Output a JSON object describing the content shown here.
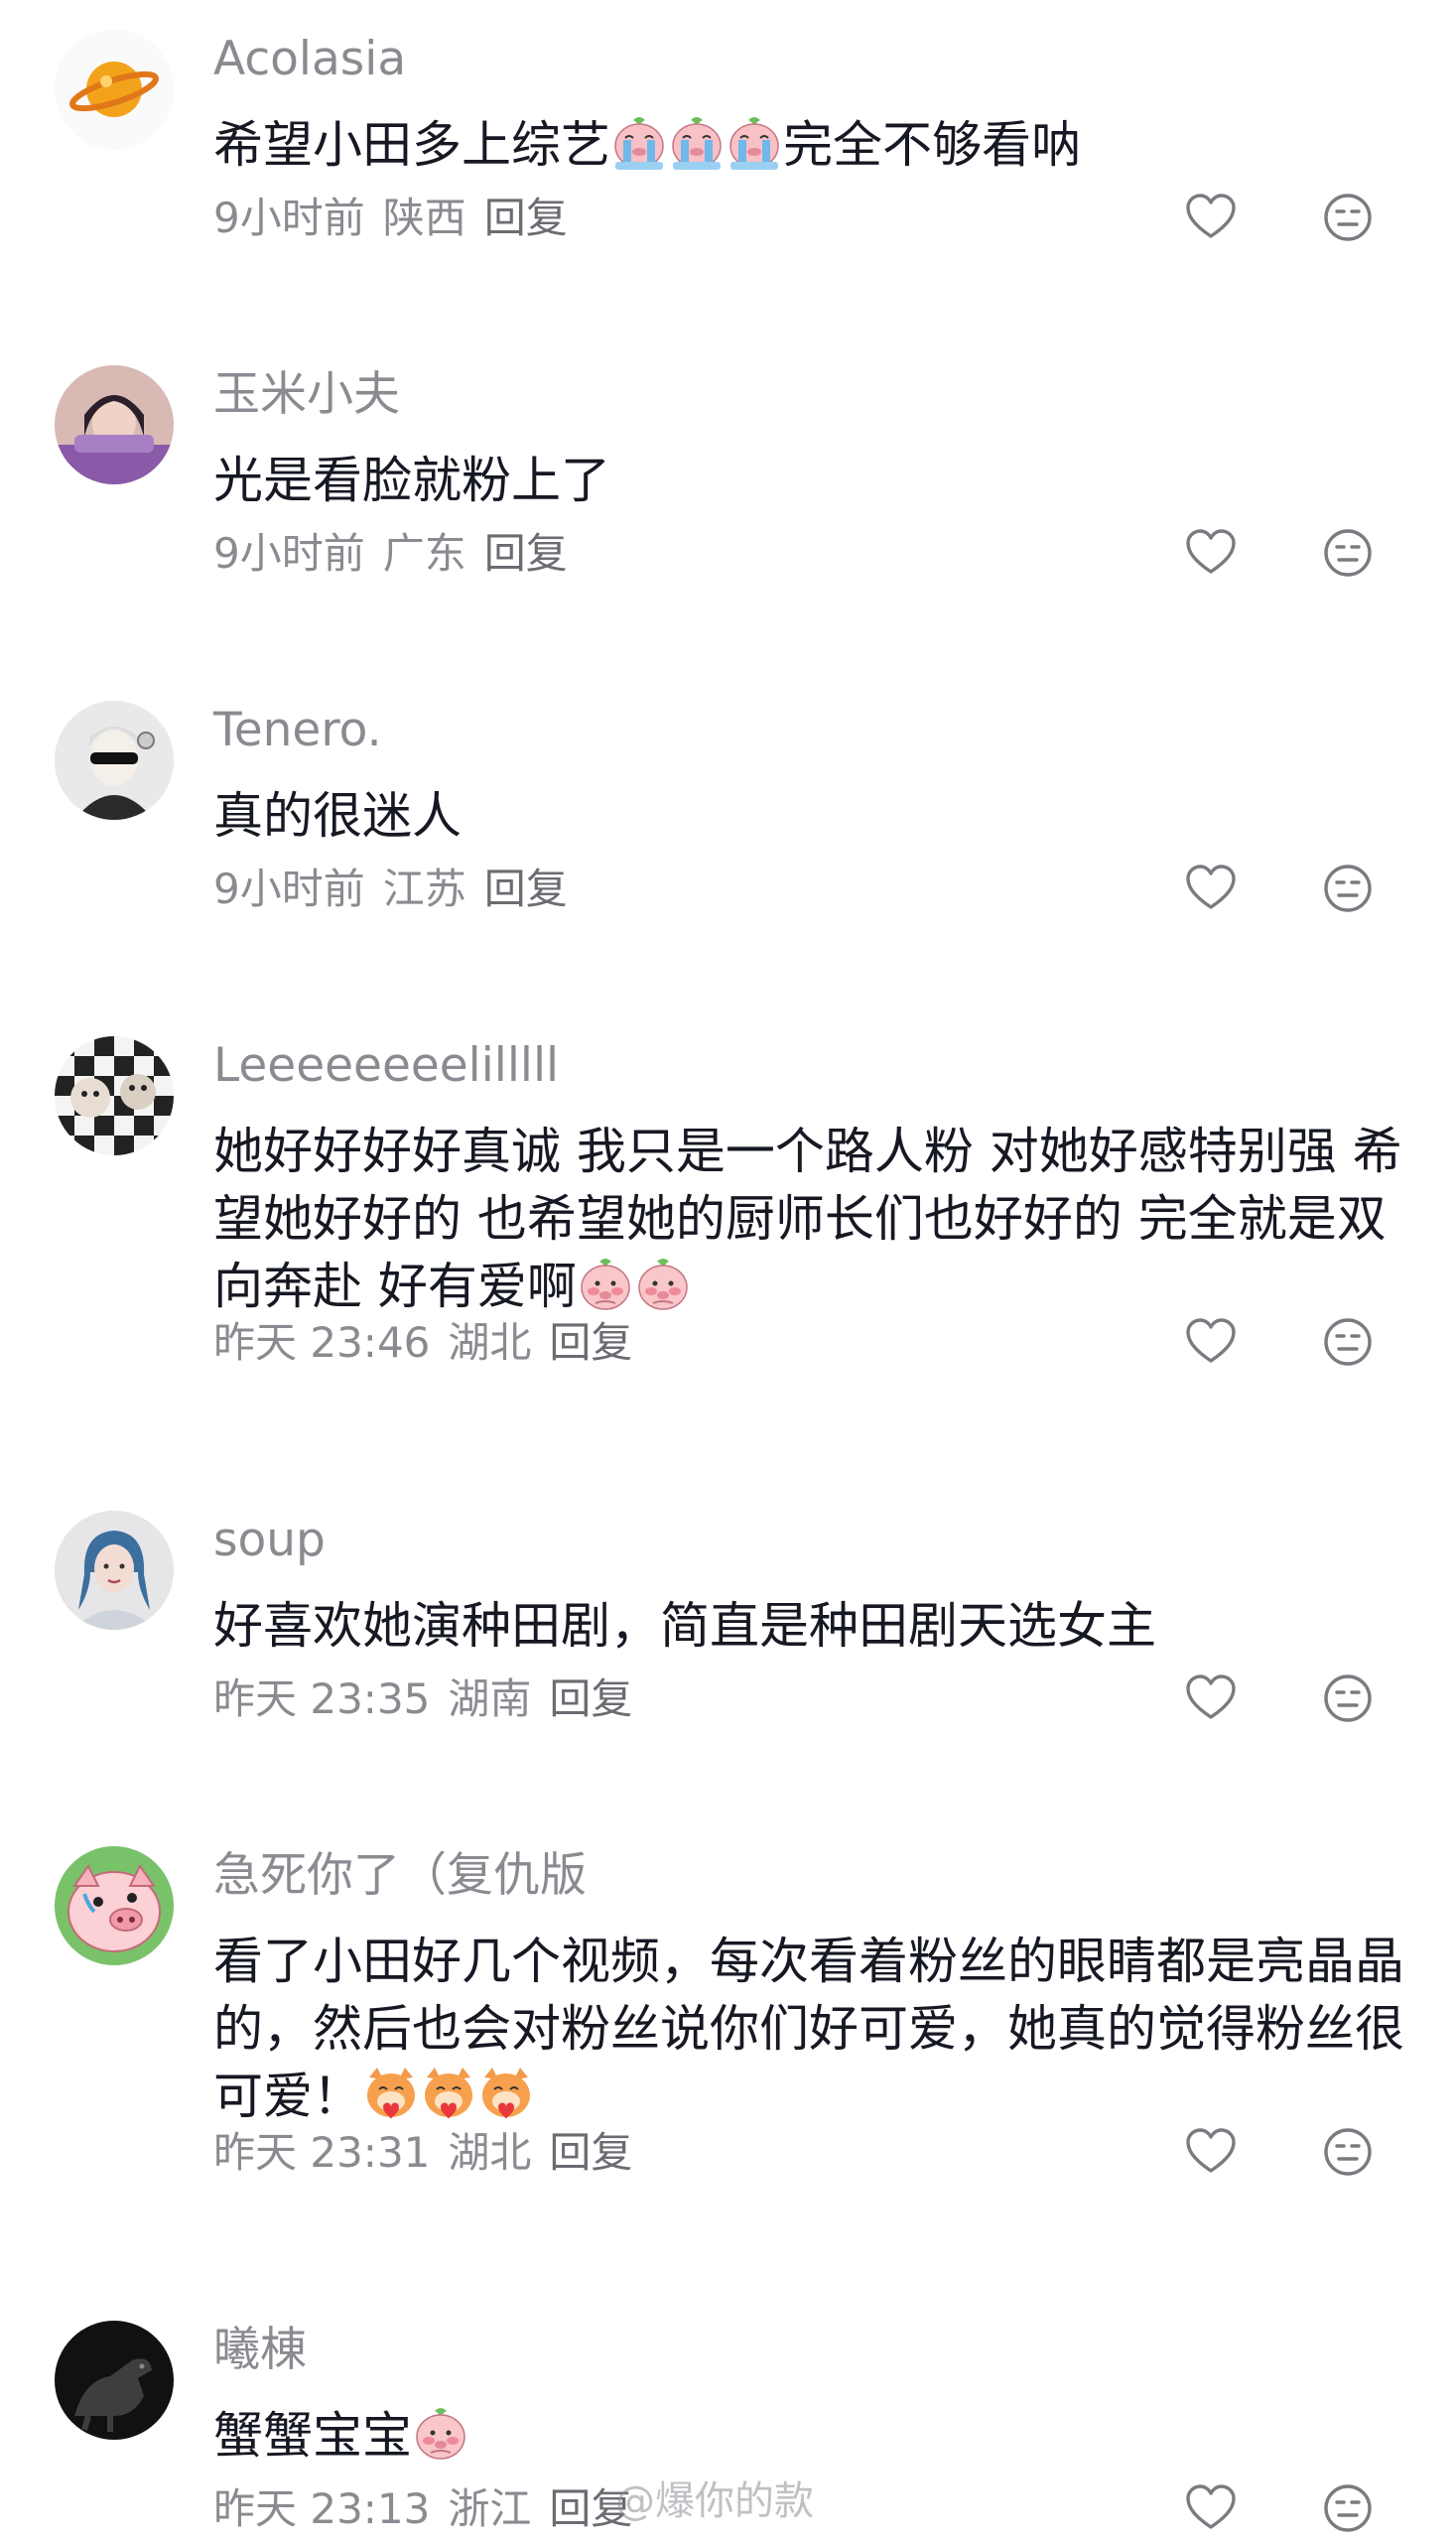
{
  "comments": [
    {
      "username": "Acolasia",
      "text_before": "希望小田多上综艺",
      "emojis": [
        "crying-pig-emoji",
        "crying-pig-emoji",
        "crying-pig-emoji"
      ],
      "text_after": "完全不够看呐",
      "time": "9小时前",
      "location": "陕西",
      "reply": "回复"
    },
    {
      "username": "玉米小夫",
      "text_before": "光是看脸就粉上了",
      "emojis": [],
      "text_after": "",
      "time": "9小时前",
      "location": "广东",
      "reply": "回复"
    },
    {
      "username": "Tenero.",
      "text_before": "真的很迷人",
      "emojis": [],
      "text_after": "",
      "time": "9小时前",
      "location": "江苏",
      "reply": "回复"
    },
    {
      "username": "Leeeeeeeelilllll",
      "text_before": "她好好好好真诚 我只是一个路人粉 对她好感特别强 希望她好好的 也希望她的厨师长们也好好的 完全就是双向奔赴 好有爱啊",
      "emojis": [
        "shy-pig-emoji",
        "shy-pig-emoji"
      ],
      "text_after": "",
      "time": "昨天 23:46",
      "location": "湖北",
      "reply": "回复"
    },
    {
      "username": "soup",
      "text_before": "好喜欢她演种田剧，简直是种田剧天选女主",
      "emojis": [],
      "text_after": "",
      "time": "昨天 23:35",
      "location": "湖南",
      "reply": "回复"
    },
    {
      "username": "急死你了（复仇版",
      "text_before": "看了小田好几个视频，每次看着粉丝的眼睛都是亮晶晶的，然后也会对粉丝说你们好可爱，她真的觉得粉丝很可爱！",
      "emojis": [
        "heart-cat-emoji",
        "heart-cat-emoji",
        "heart-cat-emoji"
      ],
      "text_after": "",
      "time": "昨天 23:31",
      "location": "湖北",
      "reply": "回复"
    },
    {
      "username": "曦棟",
      "text_before": "蟹蟹宝宝",
      "emojis": [
        "shy-pig-emoji"
      ],
      "text_after": "",
      "time": "昨天 23:13",
      "location": "浙江",
      "reply": "回复"
    }
  ],
  "watermark": "@爆你的款",
  "colors": {
    "text": "#161823",
    "secondary": "#8a8b91",
    "icon": "#7a7b80"
  },
  "icons": {
    "like": "heart-outline-icon",
    "dislike": "neutral-face-icon"
  }
}
